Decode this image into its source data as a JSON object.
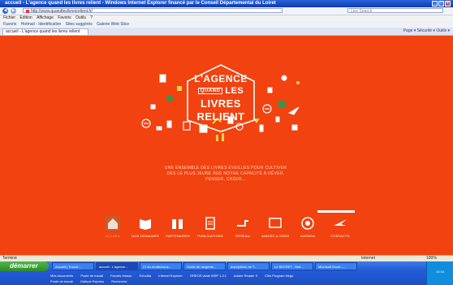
{
  "window": {
    "title": "accueil - L'agence quand les livres relient - Windows Internet Explorer financé par le Conseil Départemental du Loiret"
  },
  "address_bar": {
    "url": "http://www.quandleslivresrelient.fr/",
    "search_placeholder": "Live Search"
  },
  "menu": [
    "Fichier",
    "Edition",
    "Affichage",
    "Favoris",
    "Outils",
    "?"
  ],
  "favorites_bar": [
    "Favoris",
    "Hotmail - Identification",
    "Sites suggérés",
    "Galerie Web Slice"
  ],
  "tab": {
    "label": "accueil - L'agence quand les livres relient"
  },
  "command_bar": "Page ▾  Sécurité ▾  Outils ▾",
  "logo": {
    "line1": "L'AGENCE",
    "line2_box": "QUAND",
    "line2": "LES",
    "line3": "LIVRES",
    "line4": "RELIENT"
  },
  "tagline": [
    "UNE ENSEMBLE DES LIVRES ÉVEILLÉS POUR CULTIVER",
    "DÈS LE PLUS JEUNE ÂGE NOTRE CAPACITÉ À RÊVER,",
    "PENSER, CRÉER..."
  ],
  "nav": [
    {
      "label": "ACCUEIL",
      "icon": "house-icon",
      "active": true
    },
    {
      "label": "NOS DOMAINES",
      "icon": "open-book-icon"
    },
    {
      "label": "PARTENAIRES",
      "icon": "people-icon"
    },
    {
      "label": "PUBLICATIONS",
      "icon": "document-icon"
    },
    {
      "label": "RÉSEAU",
      "icon": "network-icon"
    },
    {
      "label": "IMAGES & SONS",
      "icon": "screen-icon"
    },
    {
      "label": "AGENDA",
      "icon": "target-icon"
    },
    {
      "label": "CONTACTS",
      "icon": "star-burst-icon"
    }
  ],
  "status_bar": {
    "left": "Terminé",
    "zone": "Internet",
    "zoom": "100%"
  },
  "taskbar": {
    "start": "démarrer",
    "items": [
      {
        "label": "Accueil | Trouvé..."
      },
      {
        "label": "accueil - L'agence...",
        "active": true
      },
      {
        "label": "Cr du rendezvous..."
      },
      {
        "label": "Guide de rangeme..."
      },
      {
        "label": "Inscriptions de T..."
      },
      {
        "label": "Le SECRET - Sed..."
      },
      {
        "label": "Microsoft Excel -..."
      }
    ],
    "quick_launch": [
      "Mes documents",
      "Poste de travail",
      "Favoris réseau",
      "Echodia",
      "Internet Explorer",
      "OREOS vitale WSP 1.3.1",
      "Adobe Reader 9",
      "Clés Program Nego",
      "Poste de travail",
      "Outlook Express",
      "Recherche"
    ],
    "clock": "10:16"
  },
  "colors": {
    "page_bg": "#f2420f",
    "titlebar": "#0b3bb4",
    "taskbar": "#225ad6",
    "start": "#2e8b2a"
  }
}
